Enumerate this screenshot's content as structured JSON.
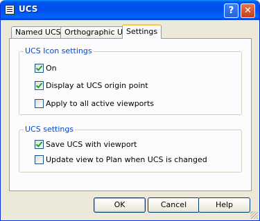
{
  "window": {
    "title": "UCS"
  },
  "title_buttons": {
    "help": "?",
    "close": "✕"
  },
  "tabs": [
    {
      "label": "Named UCSs"
    },
    {
      "label": "Orthographic UCSs"
    },
    {
      "label": "Settings",
      "active": true
    }
  ],
  "icon_settings": {
    "title": "UCS Icon settings",
    "on": {
      "label": "On",
      "checked": true
    },
    "display_origin": {
      "label": "Display at UCS origin point",
      "checked": true
    },
    "apply_all": {
      "label": "Apply to all active viewports",
      "checked": false
    }
  },
  "ucs_settings": {
    "title": "UCS settings",
    "save_with_viewport": {
      "label": "Save UCS with viewport",
      "checked": true
    },
    "update_plan": {
      "label": "Update view to Plan when UCS is changed",
      "checked": false
    }
  },
  "buttons": {
    "ok": "OK",
    "cancel": "Cancel",
    "help": "Help"
  }
}
